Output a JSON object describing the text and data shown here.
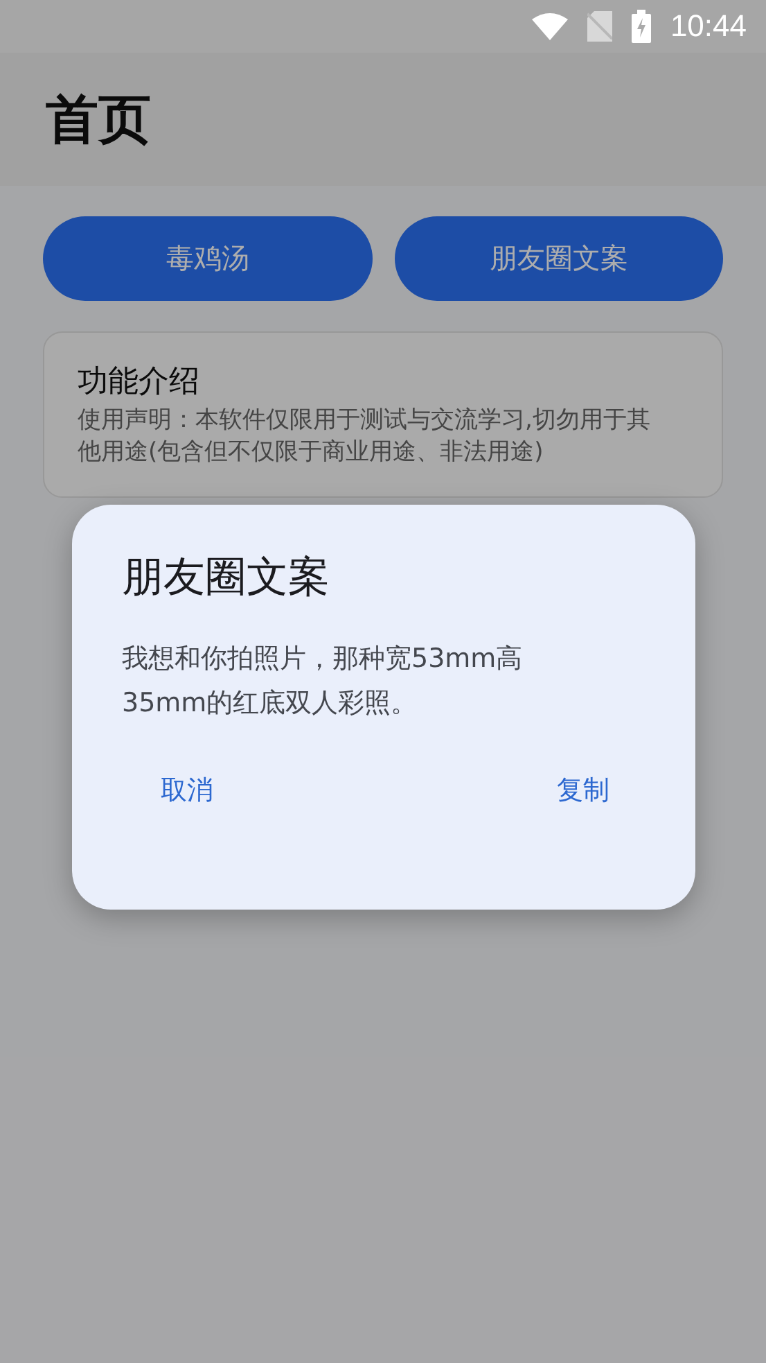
{
  "status_bar": {
    "time": "10:44"
  },
  "app_bar": {
    "title": "首页"
  },
  "buttons": [
    {
      "label": "毒鸡汤"
    },
    {
      "label": "朋友圈文案"
    }
  ],
  "card": {
    "title": "功能介绍",
    "text": "使用声明：本软件仅限用于测试与交流学习,切勿用于其他用途(包含但不仅限于商业用途、非法用途)"
  },
  "dialog": {
    "title": "朋友圈文案",
    "message": "我想和你拍照片，那种宽53mm高35mm的红底双人彩照。",
    "actions": [
      {
        "label": "取消"
      },
      {
        "label": "复制"
      }
    ]
  }
}
